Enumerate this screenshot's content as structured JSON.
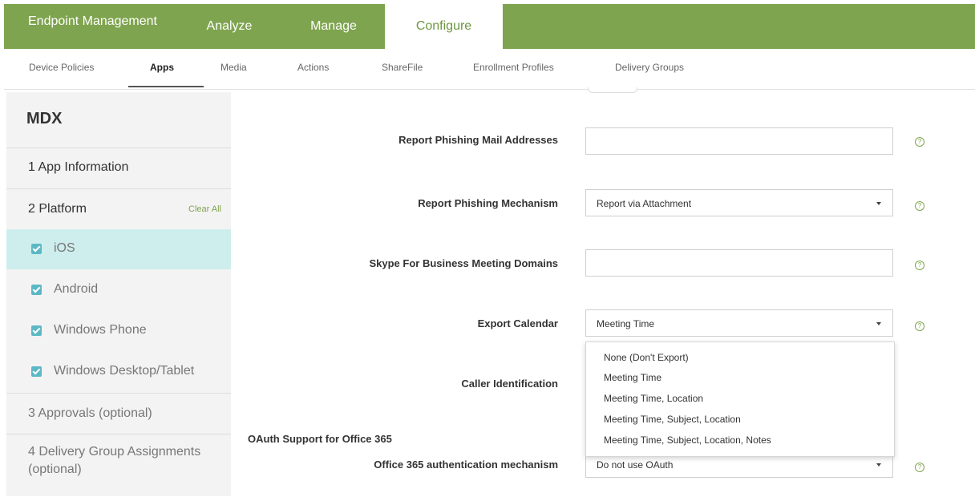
{
  "topnav": {
    "brand": "Endpoint Management",
    "tabs": [
      "Analyze",
      "Manage",
      "Configure"
    ]
  },
  "subnav": {
    "items": [
      "Device Policies",
      "Apps",
      "Media",
      "Actions",
      "ShareFile",
      "Enrollment Profiles",
      "Delivery Groups"
    ]
  },
  "sidebar": {
    "title": "MDX",
    "steps": {
      "app_info": "1 App Information",
      "platform": "2 Platform",
      "clear_all": "Clear All",
      "approvals": "3 Approvals (optional)",
      "delivery": "4 Delivery Group Assignments (optional)"
    },
    "platforms": [
      "iOS",
      "Android",
      "Windows Phone",
      "Windows Desktop/Tablet"
    ]
  },
  "form": {
    "report_phishing_addresses_label": "Report Phishing Mail Addresses",
    "report_phishing_addresses_value": "",
    "report_phishing_mechanism_label": "Report Phishing Mechanism",
    "report_phishing_mechanism_value": "Report via Attachment",
    "skype_domains_label": "Skype For Business Meeting Domains",
    "skype_domains_value": "",
    "export_calendar_label": "Export Calendar",
    "export_calendar_value": "Meeting Time",
    "caller_id_label": "Caller Identification",
    "oauth_section": "OAuth Support for Office 365",
    "o365_auth_label": "Office 365 authentication mechanism",
    "o365_auth_value": "Do not use OAuth",
    "help_glyph": "?"
  },
  "export_calendar_options": [
    "None (Don't Export)",
    "Meeting Time",
    "Meeting Time, Location",
    "Meeting Time, Subject, Location",
    "Meeting Time, Subject, Location, Notes"
  ],
  "colors": {
    "brand_green": "#7fa44f",
    "selected_row": "#cdeeed",
    "checkbox": "#5cb8c4"
  }
}
